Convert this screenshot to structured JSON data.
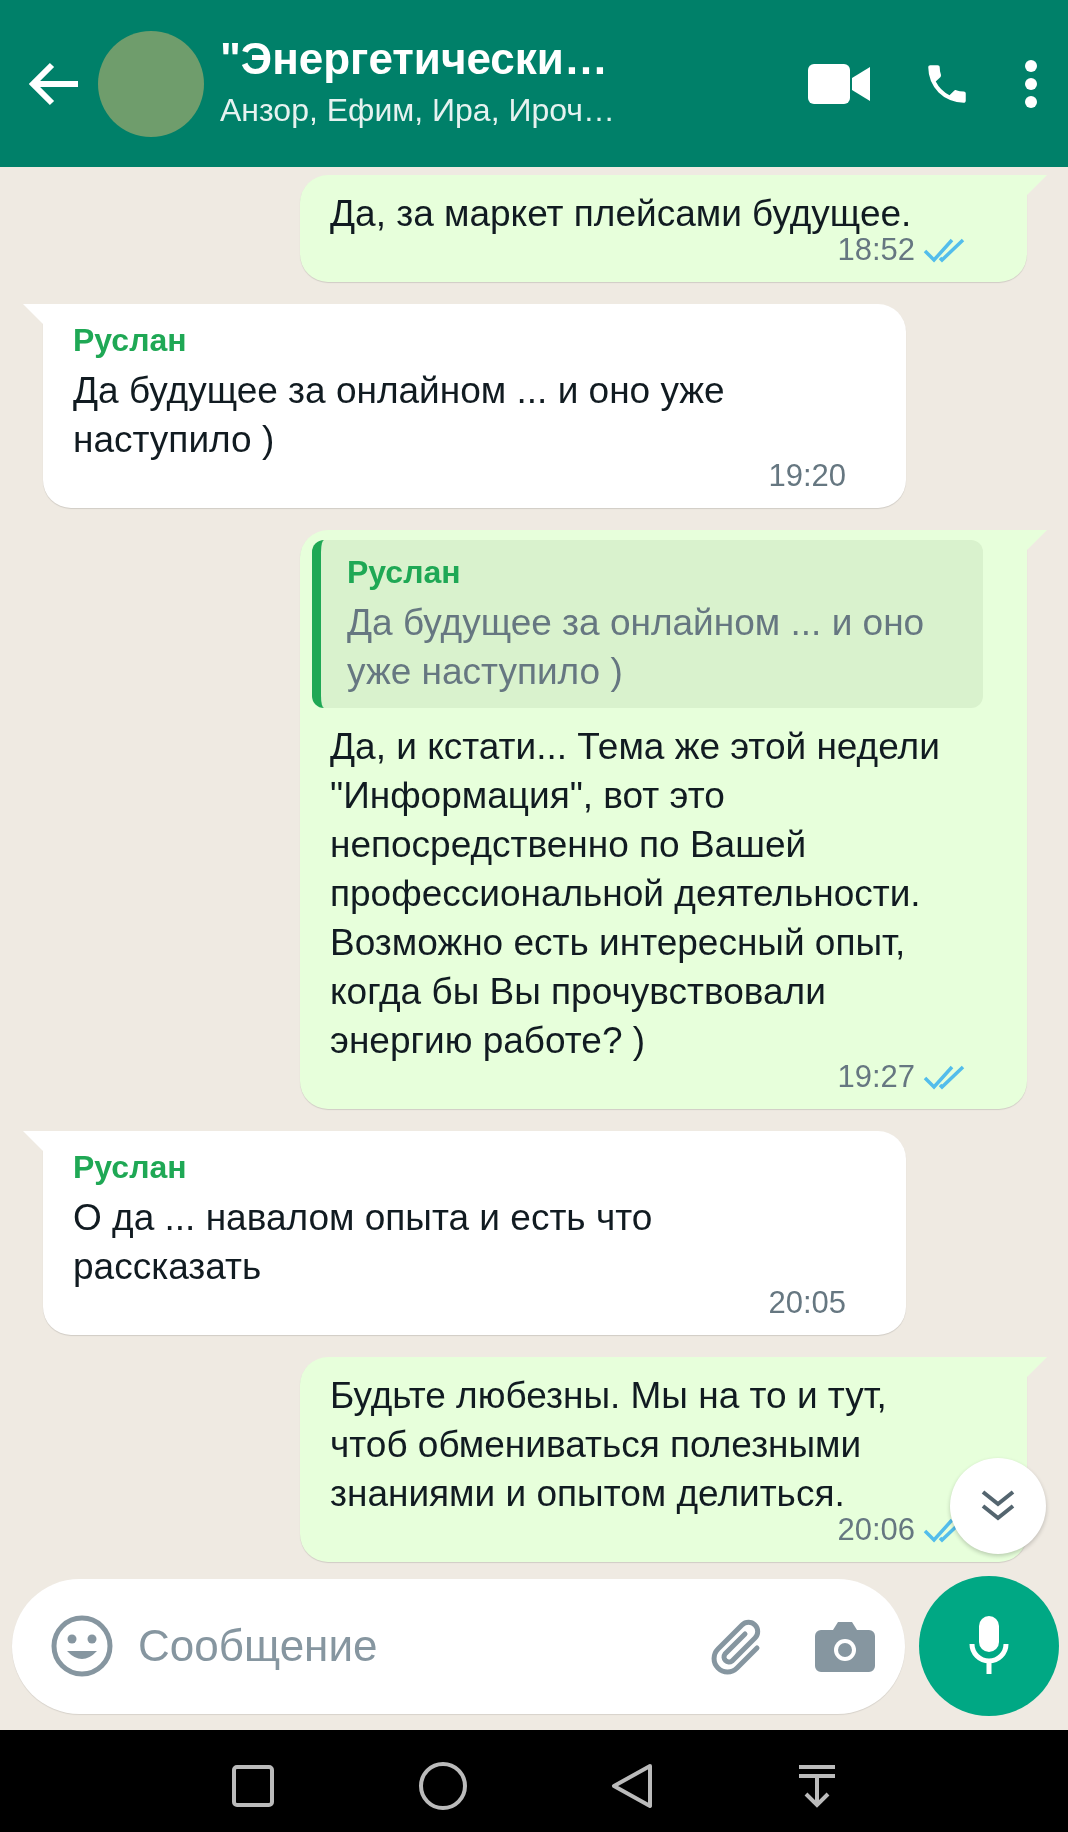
{
  "header": {
    "title": "\"Энергетически…",
    "subtitle": "Анзор, Ефим, Ира, Ироч…"
  },
  "messages": [
    {
      "kind": "outgoing",
      "text": "Да, за маркет плейсами будущее.",
      "time": "18:52",
      "read": true
    },
    {
      "kind": "incoming",
      "sender": "Руслан",
      "color": "#1fa855",
      "text": "Да будущее за онлайном ... и оно уже наступило )",
      "time": "19:20"
    },
    {
      "kind": "outgoing",
      "quote": {
        "sender": "Руслан",
        "color": "#1fa855",
        "text": "Да будущее за онлайном ... и оно уже наступило )"
      },
      "text": "Да, и кстати... Тема же этой недели \"Информация\", вот это непосредственно по Вашей профессиональной деятельности. Возможно есть интересный опыт, когда бы Вы прочувствовали энергию работе? )",
      "time": "19:27",
      "read": true
    },
    {
      "kind": "incoming",
      "sender": "Руслан",
      "color": "#1fa855",
      "text": "О да ... навалом опыта и есть что рассказать",
      "time": "20:05"
    },
    {
      "kind": "outgoing",
      "text": "Будьте любезны. Мы на то и тут, чтоб обмениваться полезными знаниями и опытом делиться.",
      "time": "20:06",
      "read": true
    }
  ],
  "composer": {
    "placeholder": "Сообщение"
  }
}
